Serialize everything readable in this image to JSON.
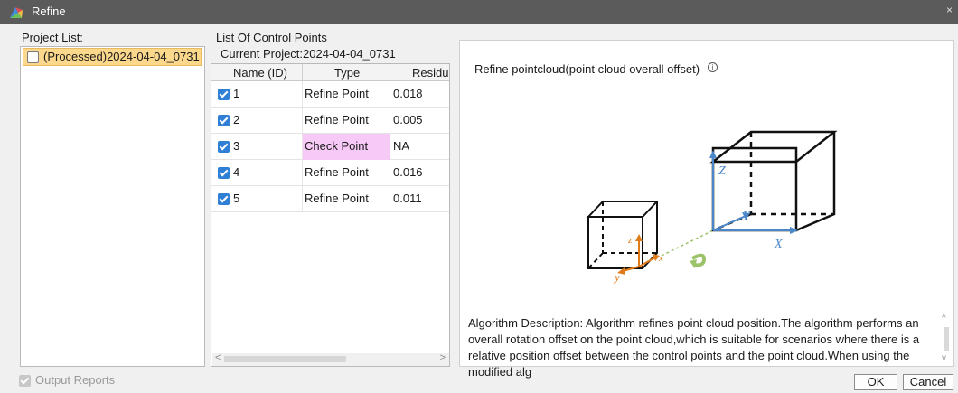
{
  "window": {
    "title": "Refine",
    "close_glyph": "×"
  },
  "project_list": {
    "label": "Project List:",
    "items": [
      {
        "label": "(Processed)2024-04-04_0731",
        "checked": false
      }
    ]
  },
  "control_points": {
    "label": "List Of Control Points",
    "current_project": "Current Project:2024-04-04_0731",
    "columns": [
      "Name (ID)",
      "Type",
      "Residu"
    ],
    "rows": [
      {
        "id": "1",
        "type": "Refine Point",
        "residual": "0.018",
        "checked": true
      },
      {
        "id": "2",
        "type": "Refine Point",
        "residual": "0.005",
        "checked": true
      },
      {
        "id": "3",
        "type": "Check Point",
        "residual": "NA",
        "checked": true
      },
      {
        "id": "4",
        "type": "Refine Point",
        "residual": "0.016",
        "checked": true
      },
      {
        "id": "5",
        "type": "Refine Point",
        "residual": "0.011",
        "checked": true
      }
    ],
    "scroll_left": "<",
    "scroll_right": ">"
  },
  "description": {
    "title": "Refine pointcloud(point cloud overall offset)",
    "info_glyph": "i",
    "diagram_labels": {
      "big_z": "Z",
      "big_y": "Y",
      "big_x": "X",
      "small_z": "z",
      "small_y": "y",
      "small_x": "x"
    },
    "algorithm_text": "Algorithm Description: Algorithm refines point cloud position.The algorithm performs an overall rotation offset on the point cloud,which is suitable for scenarios where there is a relative position offset between the control points and the point cloud.When using the modified alg",
    "scroll_up": "^",
    "scroll_down": "v"
  },
  "footer": {
    "output_reports": "Output Reports",
    "ok": "OK",
    "cancel": "Cancel"
  },
  "colors": {
    "titlebar": "#5b5b5b",
    "selected_project": "#fbd88c",
    "checkbox_blue": "#2f7fd6",
    "check_point_highlight": "#f7c9f7",
    "axis_blue": "#4a86c8",
    "axis_orange": "#e07b1a",
    "rotation_green": "#9cc36a"
  }
}
